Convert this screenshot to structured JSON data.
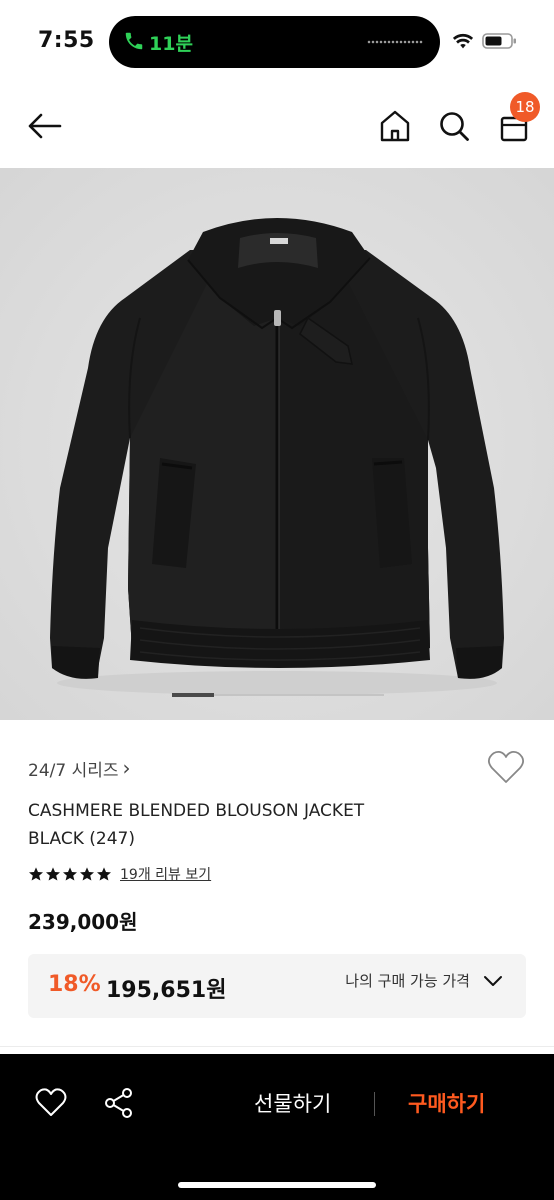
{
  "status_bar": {
    "time": "7:55",
    "call_duration": "11분"
  },
  "header": {
    "cart_badge_count": "18"
  },
  "product": {
    "image_count_indicator_position": 0.2,
    "brand": "24/7 시리즈",
    "brand_arrow": "›",
    "name": "CASHMERE BLENDED BLOUSON JACKET BLACK (247)",
    "rating_stars": 5,
    "review_link": "19개 리뷰 보기",
    "price_original": "239,000원",
    "discount_rate": "18%",
    "price_discounted": "195,651원",
    "my_price_label": "나의 구매 가능 가격"
  },
  "bottom_bar": {
    "gift_label": "선물하기",
    "buy_label": "구매하기"
  },
  "colors": {
    "accent": "#f05a28",
    "call_green": "#2fd158",
    "image_bg": "#dedede"
  }
}
